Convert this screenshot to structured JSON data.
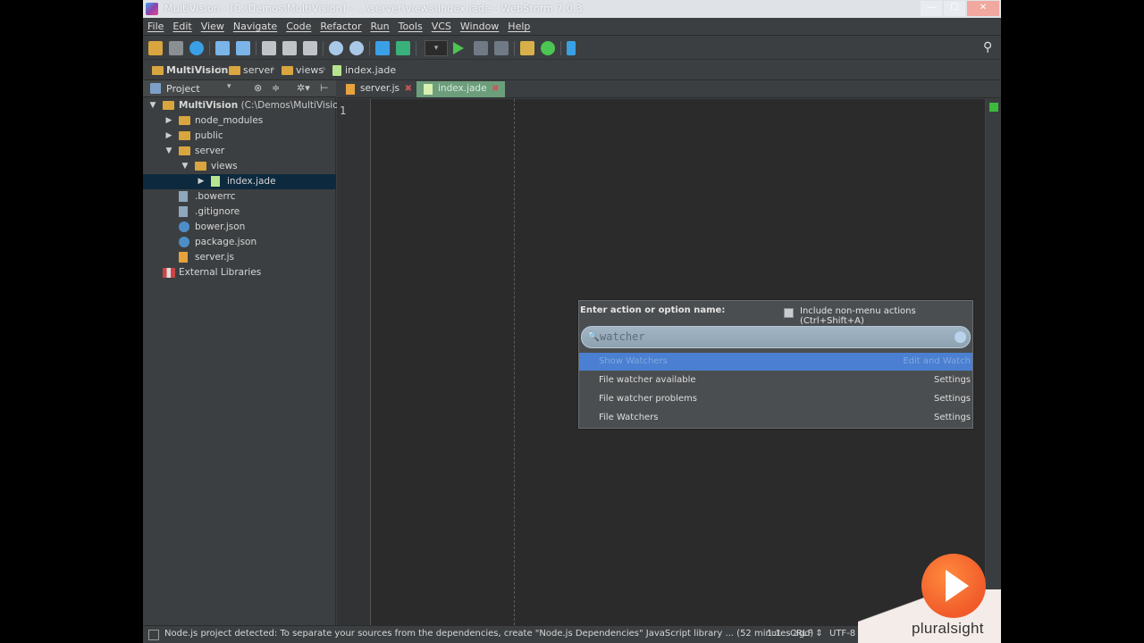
{
  "window": {
    "title": "MultiVision - [C:\\Demos\\MultiVision] - ...\\server\\views\\index.jade - WebStorm 7.0.3",
    "min": "—",
    "max": "☐",
    "close": "✕"
  },
  "menu": [
    "File",
    "Edit",
    "View",
    "Navigate",
    "Code",
    "Refactor",
    "Run",
    "Tools",
    "VCS",
    "Window",
    "Help"
  ],
  "toolbar": {
    "run_config": "▾"
  },
  "breadcrumb": {
    "items": [
      "MultiVision",
      "server",
      "views",
      "index.jade"
    ],
    "sep": "›"
  },
  "project_panel": {
    "title": "Project",
    "dropdown": "▾",
    "tools": [
      "⊗",
      "≑",
      "✲▾",
      "⊢"
    ]
  },
  "tree": [
    {
      "name": "MultiVision",
      "path": " (C:\\Demos\\MultiVision)",
      "arrow": "▼",
      "type": "folder",
      "depth": 0,
      "bold": true
    },
    {
      "name": "node_modules",
      "arrow": "▶",
      "type": "folder",
      "depth": 1
    },
    {
      "name": "public",
      "arrow": "▶",
      "type": "folder",
      "depth": 1
    },
    {
      "name": "server",
      "arrow": "▼",
      "type": "folder",
      "depth": 1
    },
    {
      "name": "views",
      "arrow": "▼",
      "type": "folder",
      "depth": 2
    },
    {
      "name": "index.jade",
      "arrow": "▶",
      "type": "file",
      "depth": 3,
      "selected": true
    },
    {
      "name": ".bowerrc",
      "arrow": "",
      "type": "cfg",
      "depth": 1
    },
    {
      "name": ".gitignore",
      "arrow": "",
      "type": "cfg",
      "depth": 1
    },
    {
      "name": "bower.json",
      "arrow": "",
      "type": "json",
      "depth": 1
    },
    {
      "name": "package.json",
      "arrow": "",
      "type": "json",
      "depth": 1
    },
    {
      "name": "server.js",
      "arrow": "",
      "type": "js",
      "depth": 1
    },
    {
      "name": "External Libraries",
      "arrow": "",
      "type": "lib",
      "depth": 0
    }
  ],
  "tabs": [
    {
      "label": "server.js",
      "active": false,
      "close": "✖"
    },
    {
      "label": "index.jade",
      "active": true,
      "close": "✖"
    }
  ],
  "editor": {
    "line_number": "1"
  },
  "find_action": {
    "prompt": "Enter action or option name:",
    "include_label": "Include non-menu actions (Ctrl+Shift+A)",
    "query": "watcher",
    "search_icon": "🔍",
    "results": [
      {
        "name": "Show Watchers",
        "group": "Edit and Watch",
        "selected": true
      },
      {
        "name": "File watcher available",
        "group": "Settings"
      },
      {
        "name": "File watcher problems",
        "group": "Settings"
      },
      {
        "name": "File Watchers",
        "group": "Settings"
      }
    ]
  },
  "status": {
    "message": "Node.js project detected: To separate your sources from the dependencies, create \"Node.js Dependencies\" JavaScript library ... (52 minutes ago)",
    "caret": "1:1",
    "line_sep": "CRLF ⇕",
    "encoding": "UTF-8"
  },
  "watermark": {
    "brand": "pluralsight"
  },
  "colors": {
    "accent_selection": "#4a7fd1",
    "tree_selection": "#0d293e",
    "active_tab": "#6d9e7c",
    "brand": "#f15b2a"
  }
}
